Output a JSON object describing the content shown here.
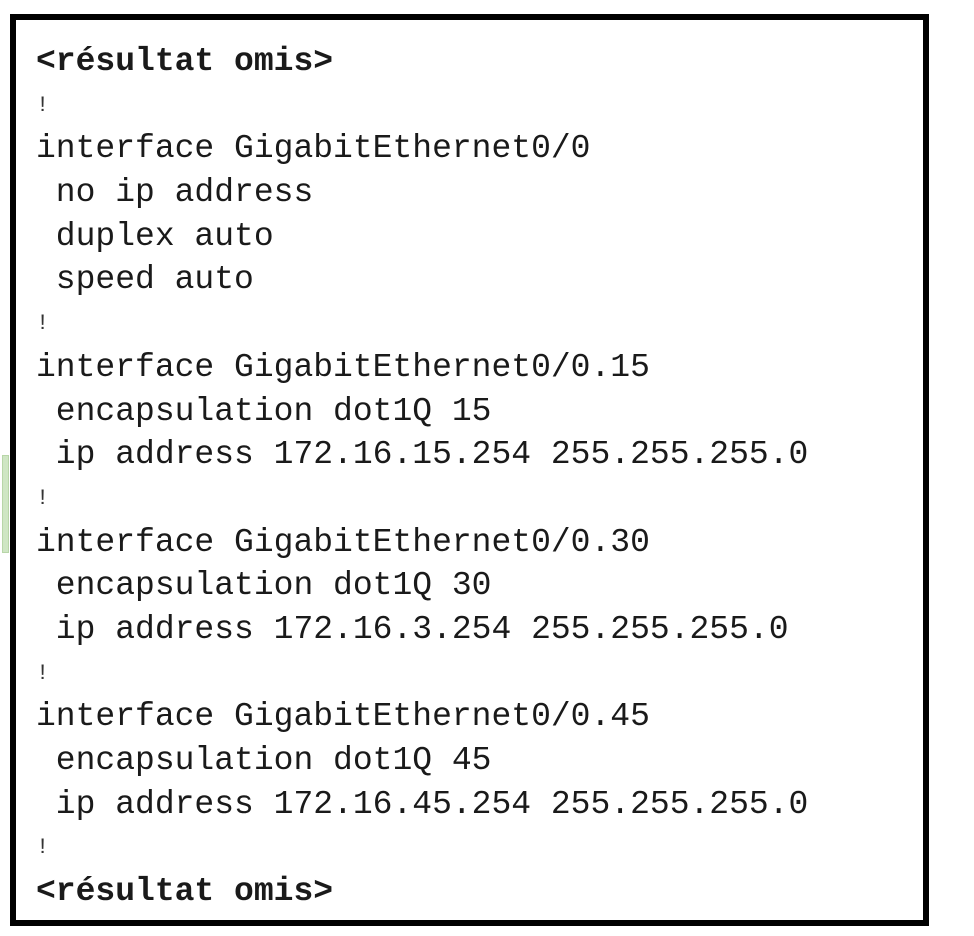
{
  "config_output": {
    "omitted_top": "<résultat omis>",
    "omitted_bottom": "<résultat omis>",
    "separator": "!",
    "lines": [
      "interface GigabitEthernet0/0",
      " no ip address",
      " duplex auto",
      " speed auto",
      "interface GigabitEthernet0/0.15",
      " encapsulation dot1Q 15",
      " ip address 172.16.15.254 255.255.255.0",
      "interface GigabitEthernet0/0.30",
      " encapsulation dot1Q 30",
      " ip address 172.16.3.254 255.255.255.0",
      "interface GigabitEthernet0/0.45",
      " encapsulation dot1Q 45",
      " ip address 172.16.45.254 255.255.255.0"
    ]
  }
}
